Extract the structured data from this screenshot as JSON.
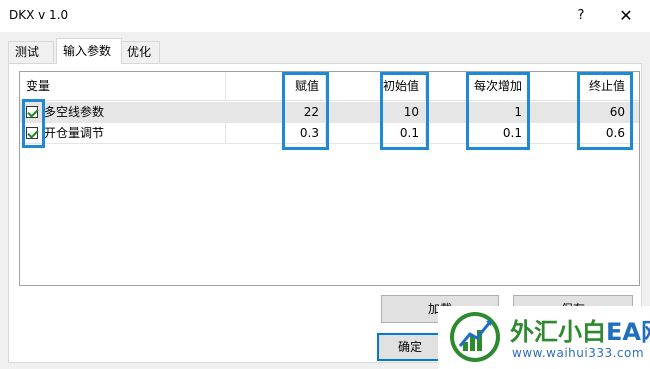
{
  "window": {
    "title": "DKX v 1.0",
    "help": "?",
    "close": "✕"
  },
  "tabs": [
    {
      "label": "测试"
    },
    {
      "label": "输入参数"
    },
    {
      "label": "优化"
    }
  ],
  "grid": {
    "columns": [
      "变量",
      "赋值",
      "初始值",
      "每次增加",
      "终止值"
    ],
    "rows": [
      {
        "checked": true,
        "name": "多空线参数",
        "value": "22",
        "start": "10",
        "step": "1",
        "stop": "60"
      },
      {
        "checked": true,
        "name": "开仓量调节",
        "value": "0.3",
        "start": "0.1",
        "step": "0.1",
        "stop": "0.6"
      }
    ]
  },
  "buttons": {
    "load": "加载",
    "save": "保存",
    "ok": "确定"
  },
  "watermark": {
    "text_a": "外汇小白",
    "text_b": "EA网",
    "url": "www.waihui333.com"
  },
  "colors": {
    "highlight": "#1e8ad6",
    "check": "#1a8a1a"
  }
}
